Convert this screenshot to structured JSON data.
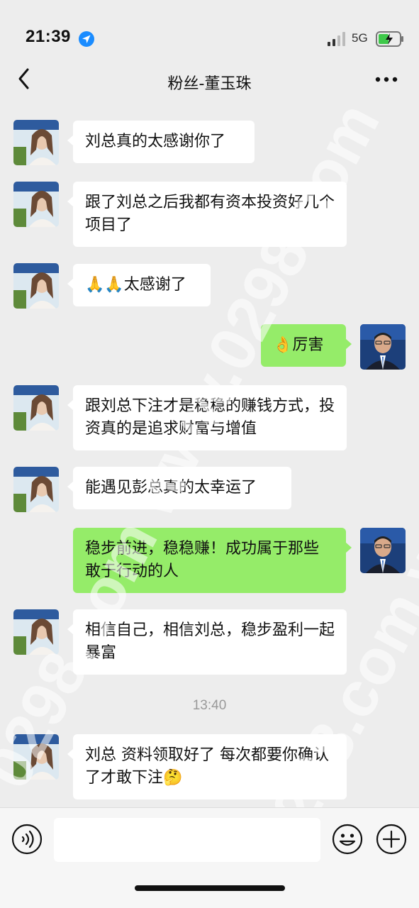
{
  "status_bar": {
    "time": "21:39",
    "network": "5G"
  },
  "nav": {
    "title": "粉丝-董玉珠"
  },
  "messages": [
    {
      "side": "left",
      "text": "刘总真的太感谢你了"
    },
    {
      "side": "left",
      "text": "跟了刘总之后我都有资本投资好几个项目了"
    },
    {
      "side": "left",
      "text": "🙏🙏太感谢了"
    },
    {
      "side": "right",
      "text": "👌厉害"
    },
    {
      "side": "left",
      "text": "跟刘总下注才是稳稳的赚钱方式，投资真的是追求财富与增值"
    },
    {
      "side": "left",
      "text": "能遇见彭总真的太幸运了"
    },
    {
      "side": "right",
      "text": "稳步前进，稳稳赚！成功属于那些敢于行动的人"
    },
    {
      "side": "left",
      "text": "相信自己，相信刘总，稳步盈利一起暴富"
    },
    {
      "side": "left",
      "text": "刘总 资料领取好了 每次都要你确认了才敢下注🤔"
    }
  ],
  "timestamp": "13:40",
  "watermark": "0298.com www.0298.com",
  "colors": {
    "self_bubble": "#95ec69",
    "other_bubble": "#ffffff",
    "background": "#ededed"
  },
  "icons": [
    "location-arrow-icon",
    "signal-icon",
    "battery-icon",
    "back-icon",
    "more-icon",
    "voice-icon",
    "emoji-icon",
    "plus-icon"
  ]
}
